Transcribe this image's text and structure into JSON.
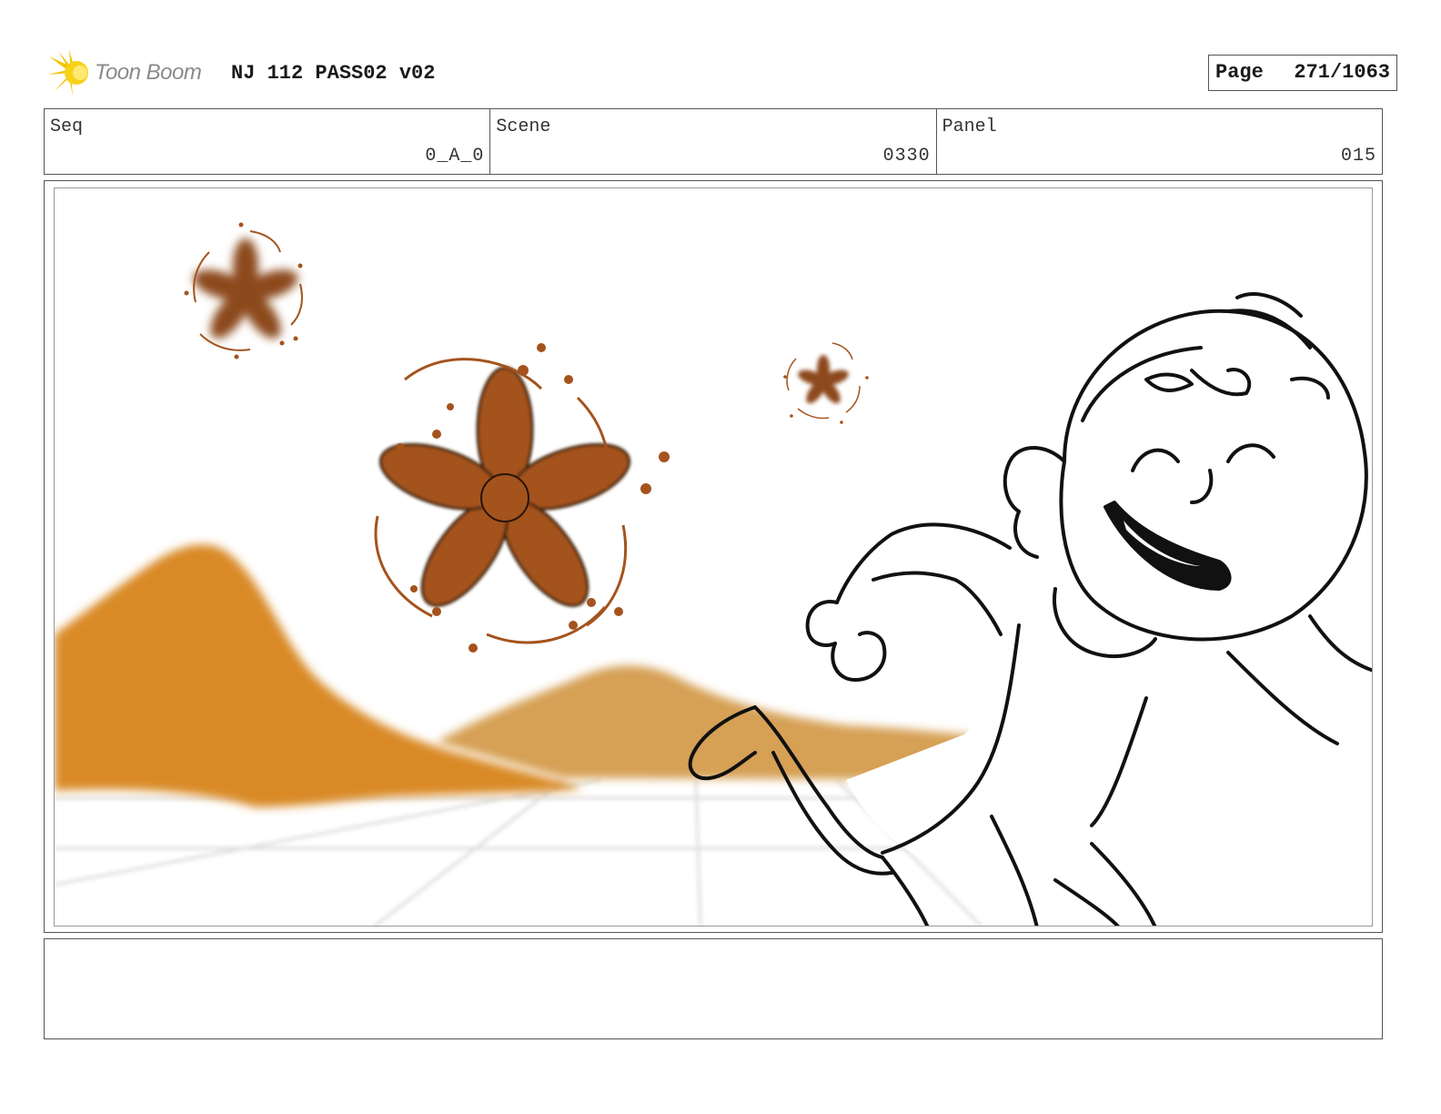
{
  "header": {
    "logo_text": "Toon Boom",
    "project_title": "NJ 112 PASS02 v02",
    "page_label": "Page",
    "page_value": "271/1063"
  },
  "meta": {
    "seq_label": "Seq",
    "seq_value": "0_A_0",
    "scene_label": "Scene",
    "scene_value": "0330",
    "panel_label": "Panel",
    "panel_value": "015"
  },
  "notes": {
    "text": ""
  },
  "colors": {
    "mountain_near": "#d98a25",
    "mountain_mid": "#d6a055",
    "mountain_right": "#e8d690",
    "star_anise": "#a4531d",
    "line_art": "#111111"
  }
}
